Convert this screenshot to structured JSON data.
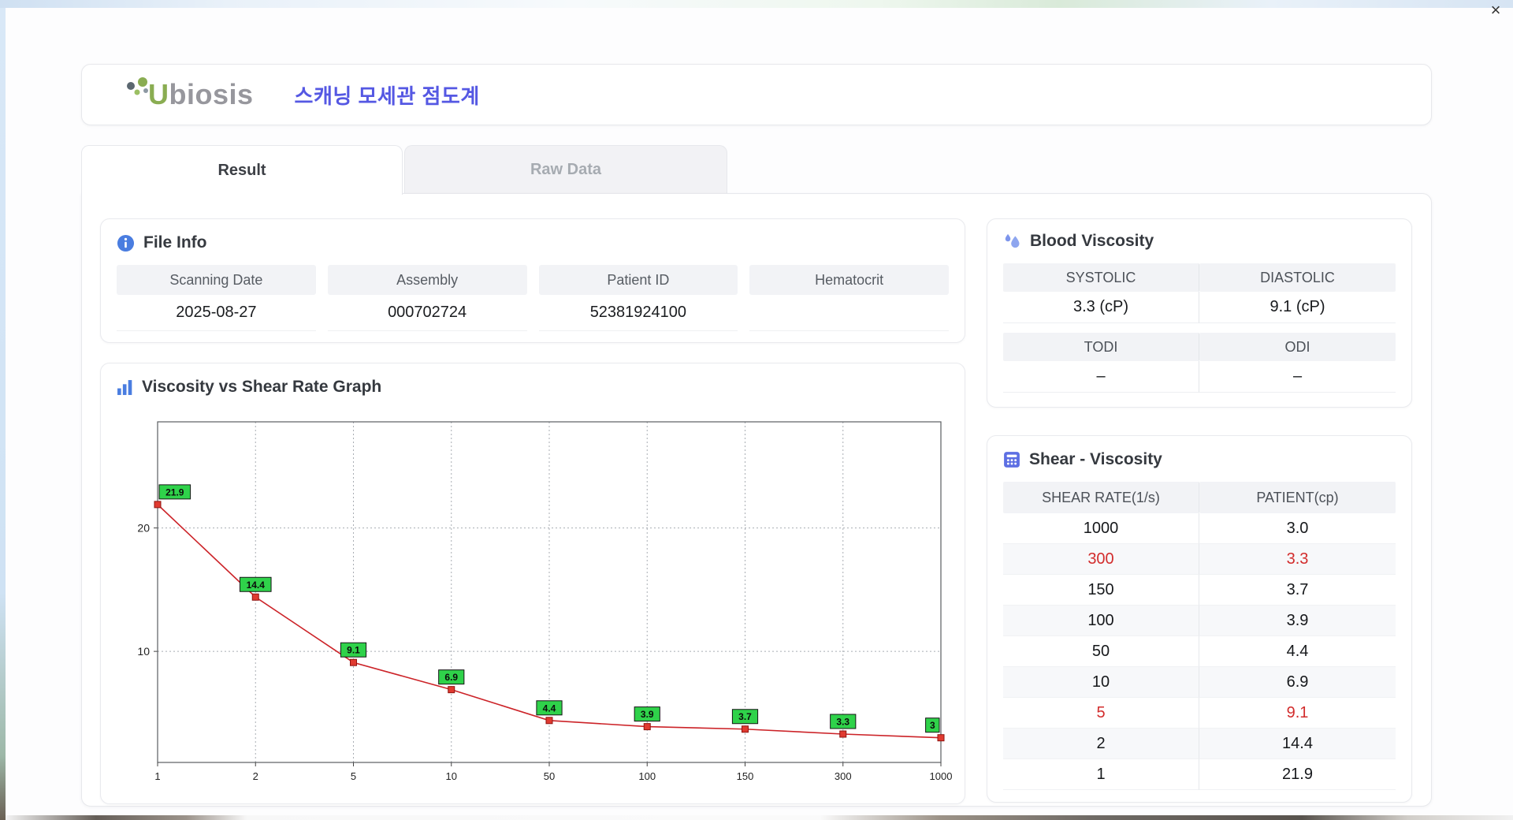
{
  "window": {
    "close_icon": "×"
  },
  "colors": {
    "title_color": "#5558e3",
    "red": "#d22c2c",
    "accent_blue": "#4a7de0"
  },
  "header": {
    "logo_text_u": "U",
    "logo_text_rest": "biosis",
    "title": "스캐닝 모세관 점도계"
  },
  "tabs": [
    {
      "label": "Result",
      "active": true
    },
    {
      "label": "Raw Data",
      "active": false
    }
  ],
  "file_info": {
    "title": "File Info",
    "fields": [
      {
        "label": "Scanning Date",
        "value": "2025-08-27"
      },
      {
        "label": "Assembly",
        "value": "000702724"
      },
      {
        "label": "Patient ID",
        "value": "52381924100"
      },
      {
        "label": "Hematocrit",
        "value": ""
      }
    ]
  },
  "blood_viscosity": {
    "title": "Blood Viscosity",
    "rows": [
      {
        "cells": [
          {
            "label": "SYSTOLIC",
            "value": "3.3 (cP)"
          },
          {
            "label": "DIASTOLIC",
            "value": "9.1 (cP)"
          }
        ]
      },
      {
        "cells": [
          {
            "label": "TODI",
            "value": "–"
          },
          {
            "label": "ODI",
            "value": "–"
          }
        ]
      }
    ]
  },
  "shear_viscosity": {
    "title": "Shear - Viscosity",
    "columns": [
      "SHEAR RATE(1/s)",
      "PATIENT(cp)"
    ],
    "rows": [
      {
        "shear": "1000",
        "patient": "3.0",
        "highlight": false
      },
      {
        "shear": "300",
        "patient": "3.3",
        "highlight": true
      },
      {
        "shear": "150",
        "patient": "3.7",
        "highlight": false
      },
      {
        "shear": "100",
        "patient": "3.9",
        "highlight": false
      },
      {
        "shear": "50",
        "patient": "4.4",
        "highlight": false
      },
      {
        "shear": "10",
        "patient": "6.9",
        "highlight": false
      },
      {
        "shear": "5",
        "patient": "9.1",
        "highlight": true
      },
      {
        "shear": "2",
        "patient": "14.4",
        "highlight": false
      },
      {
        "shear": "1",
        "patient": "21.9",
        "highlight": false
      }
    ]
  },
  "chart_data": {
    "type": "line",
    "title": "Viscosity vs Shear Rate Graph",
    "xlabel": "",
    "ylabel": "",
    "x": [
      1,
      2,
      5,
      10,
      50,
      100,
      150,
      300,
      1000
    ],
    "x_tick_labels": [
      "1",
      "2",
      "5",
      "10",
      "50",
      "100",
      "150",
      "300",
      "1000"
    ],
    "values": [
      21.9,
      14.4,
      9.1,
      6.9,
      4.4,
      3.9,
      3.7,
      3.3,
      3.0
    ],
    "point_labels": [
      "21.9",
      "14.4",
      "9.1",
      "6.9",
      "4.4",
      "3.9",
      "3.7",
      "3.3",
      "3"
    ],
    "x_scale": "category",
    "y_gridlines": [
      10,
      20
    ],
    "ylim": [
      1,
      28.6
    ],
    "grid": "dotted",
    "line_color": "#cc2328",
    "marker_color": "#e03a30",
    "marker_border": "#8f1410",
    "label_bg": "#2fd24a",
    "label_border": "#151515",
    "label_text": "#0b0b0b"
  }
}
